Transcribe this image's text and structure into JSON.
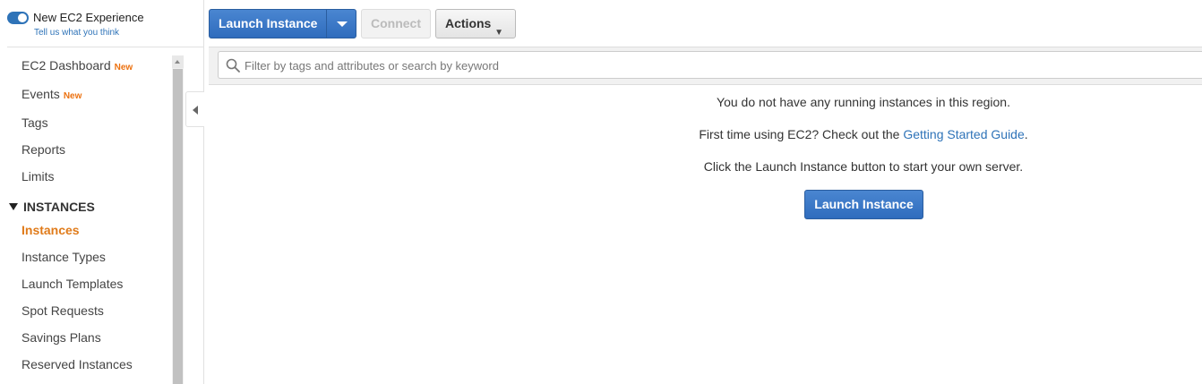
{
  "sidebar": {
    "toggle_label": "New EC2 Experience",
    "toggle_link": "Tell us what you think",
    "toggle_on": true,
    "items": [
      {
        "label": "EC2 Dashboard",
        "badge": "New"
      },
      {
        "label": "Events",
        "badge": "New"
      },
      {
        "label": "Tags"
      },
      {
        "label": "Reports"
      },
      {
        "label": "Limits"
      }
    ],
    "section": "INSTANCES",
    "section_items": [
      {
        "label": "Instances",
        "active": true
      },
      {
        "label": "Instance Types"
      },
      {
        "label": "Launch Templates"
      },
      {
        "label": "Spot Requests"
      },
      {
        "label": "Savings Plans"
      },
      {
        "label": "Reserved Instances"
      }
    ]
  },
  "toolbar": {
    "launch_label": "Launch Instance",
    "connect_label": "Connect",
    "actions_label": "Actions",
    "actions_caret": "▼"
  },
  "search": {
    "placeholder": "Filter by tags and attributes or search by keyword"
  },
  "empty_state": {
    "line1": "You do not have any running instances in this region.",
    "line2_prefix": "First time using EC2? Check out the",
    "line2_link": "Getting Started Guide",
    "line2_suffix": ".",
    "line3": "Click the Launch Instance button to start your own server.",
    "button_label": "Launch Instance"
  },
  "colors": {
    "accent_blue": "#2e73b8",
    "active_orange": "#e07b1a",
    "new_badge": "#ec7211"
  }
}
